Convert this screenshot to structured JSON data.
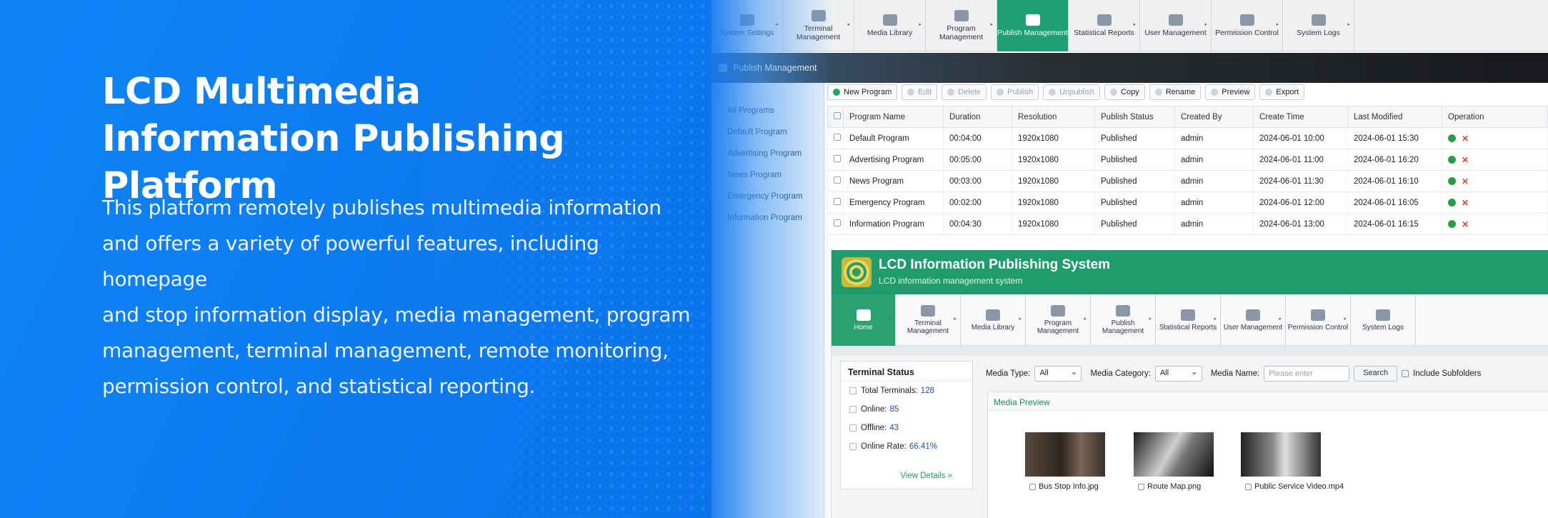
{
  "banner": {
    "headline_line1": "LCD Multimedia",
    "headline_line2": "Information Publishing Platform",
    "description_lines": [
      "This platform remotely publishes multimedia information",
      "and offers a variety of powerful features, including homepage",
      "and stop information display, media management, program",
      "management, terminal management, remote monitoring,",
      "permission control, and statistical reporting."
    ]
  },
  "shot1": {
    "nav": [
      {
        "label": "System Settings",
        "icon": "gear-icon"
      },
      {
        "label": "Terminal Management",
        "icon": "monitor-icon"
      },
      {
        "label": "Media Library",
        "icon": "folder-icon"
      },
      {
        "label": "Program Management",
        "icon": "film-icon"
      },
      {
        "label": "Publish Management",
        "icon": "cloud-upload-icon",
        "active": true
      },
      {
        "label": "Statistical Reports",
        "icon": "bar-chart-icon"
      },
      {
        "label": "User Management",
        "icon": "users-icon"
      },
      {
        "label": "Permission Control",
        "icon": "key-icon"
      },
      {
        "label": "System Logs",
        "icon": "globe-icon"
      }
    ],
    "section_title": "Publish Management",
    "sidebar": {
      "items": [
        "All Programs",
        "Default Program",
        "Advertising Program",
        "News Program",
        "Emergency Program",
        "Information Program"
      ]
    },
    "toolbar": [
      "New Program",
      "Edit",
      "Delete",
      "Publish",
      "Unpublish",
      "Copy",
      "Rename",
      "Preview",
      "Export"
    ],
    "table": {
      "columns": [
        "Program Name",
        "Duration",
        "Resolution",
        "Publish Status",
        "Created By",
        "Create Time",
        "Last Modified",
        "Operation"
      ],
      "rows": [
        [
          "Default Program",
          "00:04:00",
          "1920x1080",
          "Published",
          "admin",
          "2024-06-01 10:00",
          "2024-06-01 15:30"
        ],
        [
          "Advertising Program",
          "00:05:00",
          "1920x1080",
          "Published",
          "admin",
          "2024-06-01 11:00",
          "2024-06-01 16:20"
        ],
        [
          "News Program",
          "00:03:00",
          "1920x1080",
          "Published",
          "admin",
          "2024-06-01 11:30",
          "2024-06-01 16:10"
        ],
        [
          "Emergency Program",
          "00:02:00",
          "1920x1080",
          "Published",
          "admin",
          "2024-06-01 12:00",
          "2024-06-01 16:05"
        ],
        [
          "Information Program",
          "00:04:30",
          "1920x1080",
          "Published",
          "admin",
          "2024-06-01 13:00",
          "2024-06-01 16:15"
        ]
      ]
    }
  },
  "shot2": {
    "title": "LCD Information Publishing System",
    "subtitle": "LCD information management system",
    "nav": [
      {
        "label": "Home",
        "active": true
      },
      {
        "label": "Terminal Management"
      },
      {
        "label": "Media Library"
      },
      {
        "label": "Program Management"
      },
      {
        "label": "Publish Management"
      },
      {
        "label": "Statistical Reports"
      },
      {
        "label": "User Management"
      },
      {
        "label": "Permission Control"
      },
      {
        "label": "System Logs"
      }
    ],
    "terminal_status": {
      "title": "Terminal Status",
      "rows": [
        {
          "label": "Total Terminals:",
          "value": "128"
        },
        {
          "label": "Online:",
          "value": "85"
        },
        {
          "label": "Offline:",
          "value": "43"
        },
        {
          "label": "Online Rate:",
          "value": "66.41%"
        }
      ],
      "link": "View Details »"
    },
    "filter": {
      "media_type_label": "Media Type:",
      "media_type_value": "All",
      "media_category_label": "Media Category:",
      "media_category_value": "All",
      "media_name_label": "Media Name:",
      "media_name_placeholder": "Please enter",
      "search_label": "Search",
      "include_subfolders_label": "Include Subfolders"
    },
    "preview": {
      "title": "Media Preview",
      "items": [
        "Bus Stop Info.jpg",
        "Route Map.png",
        "Public Service Video.mp4"
      ]
    }
  }
}
